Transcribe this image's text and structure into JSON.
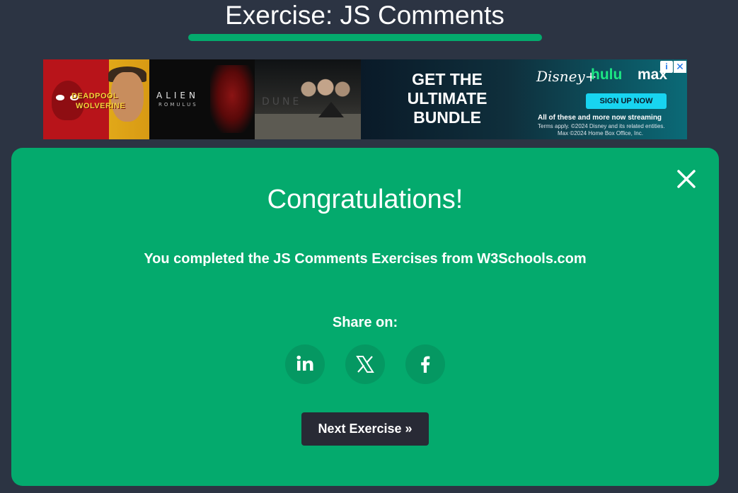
{
  "header": {
    "title": "Exercise: JS Comments",
    "underline_color": "#04aa6d"
  },
  "ad": {
    "panels": [
      {
        "text_top": "DEADPOOL",
        "text_bottom": "WOLVERINE"
      },
      {
        "title": "ALIEN",
        "subtitle": "ROMULUS"
      },
      {
        "title": "DUNE"
      }
    ],
    "headline": "GET THE ULTIMATE BUNDLE",
    "brands": [
      "Disney+",
      "hulu",
      "max"
    ],
    "signup_label": "SIGN UP NOW",
    "line1": "All of these and more now streaming",
    "line2": "Terms apply. ©2024 Disney and its related entities.",
    "line3": "Max ©2024 Home Box Office, Inc.",
    "adchoices_icon": "info-icon",
    "close_icon": "close-icon"
  },
  "modal": {
    "background": "#04aa6d",
    "title": "Congratulations!",
    "message": "You completed the JS Comments Exercises from W3Schools.com",
    "share_label": "Share on:",
    "share_buttons": [
      {
        "network": "linkedin",
        "icon": "linkedin-icon"
      },
      {
        "network": "x",
        "icon": "x-icon"
      },
      {
        "network": "facebook",
        "icon": "facebook-icon"
      }
    ],
    "next_button": "Next Exercise »",
    "close_icon": "close-icon"
  }
}
